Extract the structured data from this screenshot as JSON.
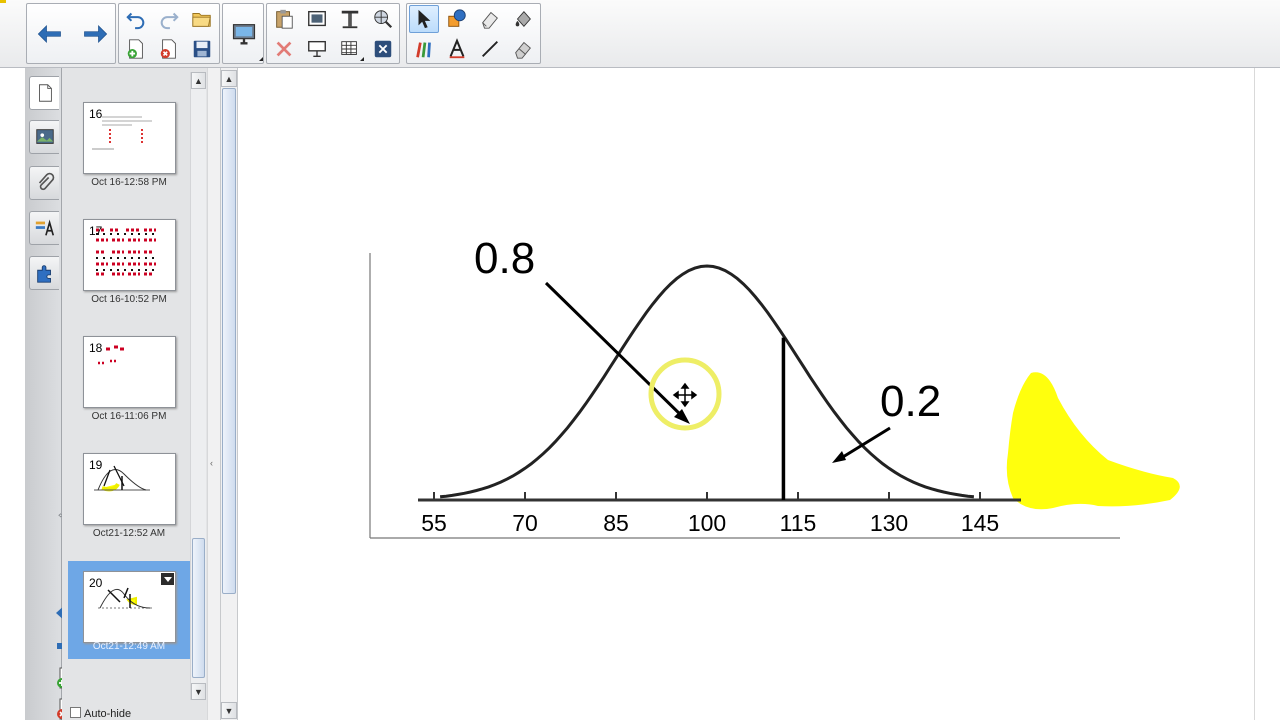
{
  "toolbar": {
    "buttons": [
      {
        "name": "back",
        "icon": "arrow-left-icon"
      },
      {
        "name": "forward",
        "icon": "arrow-right-icon"
      },
      {
        "name": "undo",
        "icon": "undo-icon"
      },
      {
        "name": "redo",
        "icon": "redo-icon"
      },
      {
        "name": "open",
        "icon": "folder-icon"
      },
      {
        "name": "add-page",
        "icon": "add-page-icon"
      },
      {
        "name": "delete-page",
        "icon": "delete-page-icon"
      },
      {
        "name": "save",
        "icon": "save-icon"
      },
      {
        "name": "display",
        "icon": "monitor-icon"
      },
      {
        "name": "paste",
        "icon": "paste-icon"
      },
      {
        "name": "screen-capture",
        "icon": "screen-capture-icon"
      },
      {
        "name": "screen-shade",
        "icon": "screen-shade-icon"
      },
      {
        "name": "smart-gallery",
        "icon": "gallery-icon"
      },
      {
        "name": "delete",
        "icon": "delete-icon"
      },
      {
        "name": "table",
        "icon": "table-icon"
      },
      {
        "name": "full-screen",
        "icon": "fullscreen-icon"
      },
      {
        "name": "select",
        "icon": "pointer-icon"
      },
      {
        "name": "shapes",
        "icon": "shapes-icon"
      },
      {
        "name": "eraser",
        "icon": "eraser-icon"
      },
      {
        "name": "fill",
        "icon": "fill-icon"
      },
      {
        "name": "pens",
        "icon": "pens-icon"
      },
      {
        "name": "text",
        "icon": "text-icon"
      },
      {
        "name": "line",
        "icon": "line-icon"
      },
      {
        "name": "eraser-2",
        "icon": "eraser-icon"
      }
    ]
  },
  "side_tabs": [
    "page-sorter-icon",
    "gallery-icon",
    "attachments-icon",
    "properties-icon",
    "addons-icon"
  ],
  "sorter": {
    "pages": [
      {
        "num": "16",
        "date": "Oct 16-12:58 PM",
        "selected": false
      },
      {
        "num": "17",
        "date": "Oct 16-10:52 PM",
        "selected": false
      },
      {
        "num": "18",
        "date": "Oct 16-11:06 PM",
        "selected": false
      },
      {
        "num": "19",
        "date": "Oct21-12:52 AM",
        "selected": false
      },
      {
        "num": "20",
        "date": "Oct21-12:49 AM",
        "selected": true
      }
    ],
    "autohide_label": "Auto-hide"
  },
  "canvas": {
    "label_left": "0.8",
    "label_right": "0.2",
    "highlight_color": "#ffff00",
    "ring_color": "#eeee66"
  },
  "chart_data": {
    "type": "line",
    "title": "",
    "xlabel": "",
    "ylabel": "",
    "x_ticks": [
      "55",
      "70",
      "85",
      "100",
      "115",
      "130",
      "145"
    ],
    "x": [
      55,
      70,
      85,
      100,
      115,
      130,
      145
    ],
    "mean": 100,
    "sd": 15,
    "cutoff": 112.6,
    "shaded_region": "right tail beyond cutoff",
    "annotations": [
      {
        "text": "0.8",
        "points_to": "area left of cutoff"
      },
      {
        "text": "0.2",
        "points_to": "shaded right tail"
      }
    ]
  }
}
